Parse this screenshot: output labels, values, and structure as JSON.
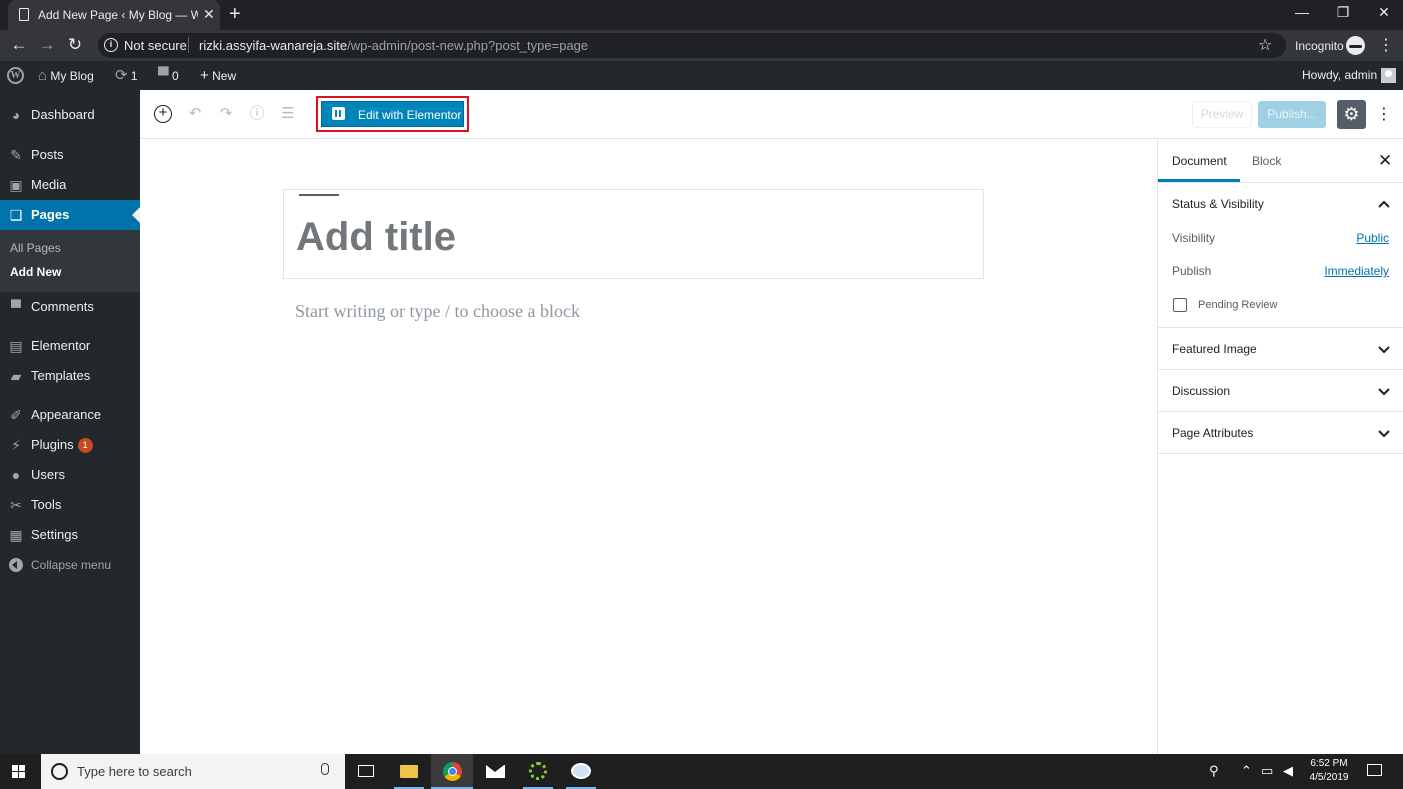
{
  "browser": {
    "tab_title": "Add New Page ‹ My Blog — WordPress",
    "security_label": "Not secure",
    "url_host": "rizki.assyifa-wanareja.site",
    "url_path": "/wp-admin/post-new.php?post_type=page",
    "profile_label": "Incognito"
  },
  "adminbar": {
    "site_name": "My Blog",
    "updates_count": "1",
    "comments_count": "0",
    "new_label": "New",
    "howdy": "Howdy, admin"
  },
  "sidebar": {
    "items": [
      {
        "label": "Dashboard",
        "icon": "dashboard-icon"
      },
      {
        "label": "Posts",
        "icon": "pin-icon"
      },
      {
        "label": "Media",
        "icon": "media-icon"
      },
      {
        "label": "Pages",
        "icon": "pages-icon"
      },
      {
        "label": "Comments",
        "icon": "comment-icon"
      },
      {
        "label": "Elementor",
        "icon": "elementor-icon"
      },
      {
        "label": "Templates",
        "icon": "folder-icon"
      },
      {
        "label": "Appearance",
        "icon": "brush-icon"
      },
      {
        "label": "Plugins",
        "icon": "plugin-icon"
      },
      {
        "label": "Users",
        "icon": "user-icon"
      },
      {
        "label": "Tools",
        "icon": "wrench-icon"
      },
      {
        "label": "Settings",
        "icon": "settings-icon"
      }
    ],
    "submenu": [
      "All Pages",
      "Add New"
    ],
    "plugins_badge": "1",
    "collapse_label": "Collapse menu"
  },
  "toolbar": {
    "elementor_label": "Edit with Elementor",
    "preview_label": "Preview",
    "publish_label": "Publish..."
  },
  "editor": {
    "title_placeholder": "Add title",
    "block_placeholder": "Start writing or type / to choose a block"
  },
  "settings_sidebar": {
    "tab_document": "Document",
    "tab_block": "Block",
    "status_visibility": "Status & Visibility",
    "visibility_label": "Visibility",
    "visibility_value": "Public",
    "publish_label": "Publish",
    "publish_value": "Immediately",
    "pending_review": "Pending Review",
    "featured_image": "Featured Image",
    "discussion": "Discussion",
    "page_attributes": "Page Attributes"
  },
  "taskbar": {
    "search_placeholder": "Type here to search",
    "time": "6:52 PM",
    "date": "4/5/2019"
  },
  "colors": {
    "wp_blue": "#0073aa",
    "elementor_button": "#0085ba",
    "highlight_border": "#e0101c",
    "admin_dark": "#23282d"
  }
}
